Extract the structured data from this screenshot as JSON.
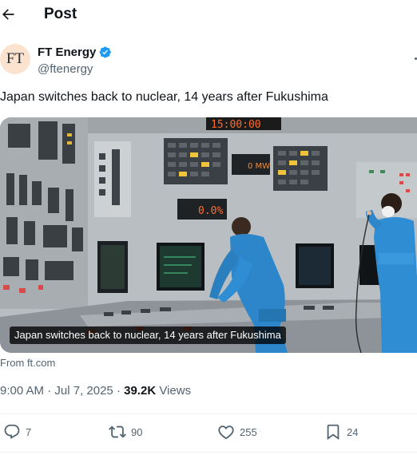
{
  "header": {
    "title": "Post"
  },
  "author": {
    "avatar_text": "FT",
    "name": "FT Energy",
    "handle": "@ftenergy",
    "verified": true
  },
  "tweet": {
    "text": "Japan switches back to nuclear, 14 years after Fukushima"
  },
  "media": {
    "caption": "Japan switches back to nuclear, 14 years after Fukushima",
    "panel_readout_top": "15:00:00",
    "panel_readout_mid": "0.0%",
    "panel_readout_small": "0 MW"
  },
  "source": {
    "label": "From ft.com"
  },
  "meta": {
    "time": "9:00 AM",
    "separator": " · ",
    "date": "Jul 7, 2025",
    "views_count": "39.2K",
    "views_label": "Views"
  },
  "actions": {
    "replies": "7",
    "reposts": "90",
    "likes": "255",
    "bookmarks": "24"
  },
  "colors": {
    "text": "#0f1419",
    "secondary": "#536471",
    "verified_blue": "#1d9bf0",
    "divider": "#eff3f4",
    "avatar_bg": "#fbe3cf"
  },
  "icons": [
    "back-arrow-icon",
    "verified-badge-icon",
    "reply-icon",
    "repost-icon",
    "like-icon",
    "bookmark-icon"
  ]
}
